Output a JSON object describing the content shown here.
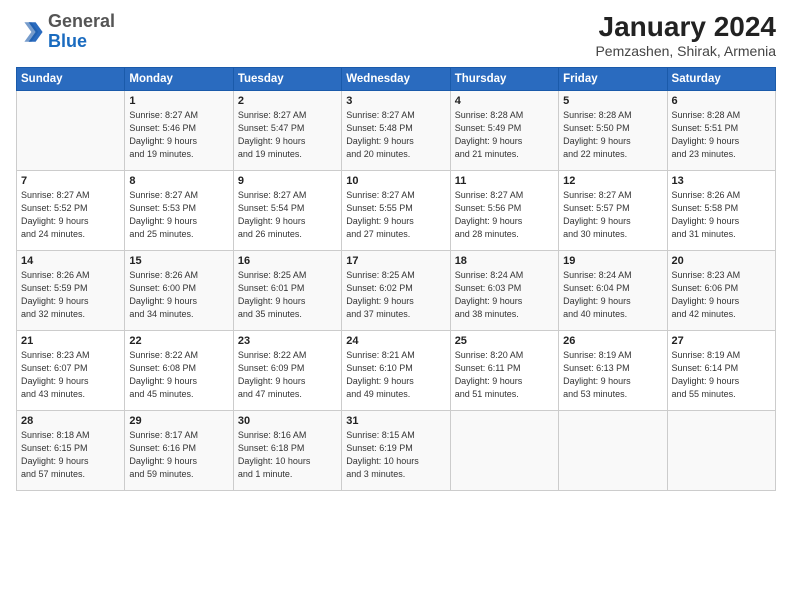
{
  "header": {
    "title": "January 2024",
    "subtitle": "Pemzashen, Shirak, Armenia",
    "logo_general": "General",
    "logo_blue": "Blue"
  },
  "days_of_week": [
    "Sunday",
    "Monday",
    "Tuesday",
    "Wednesday",
    "Thursday",
    "Friday",
    "Saturday"
  ],
  "weeks": [
    [
      {
        "day": "",
        "info": ""
      },
      {
        "day": "1",
        "info": "Sunrise: 8:27 AM\nSunset: 5:46 PM\nDaylight: 9 hours\nand 19 minutes."
      },
      {
        "day": "2",
        "info": "Sunrise: 8:27 AM\nSunset: 5:47 PM\nDaylight: 9 hours\nand 19 minutes."
      },
      {
        "day": "3",
        "info": "Sunrise: 8:27 AM\nSunset: 5:48 PM\nDaylight: 9 hours\nand 20 minutes."
      },
      {
        "day": "4",
        "info": "Sunrise: 8:28 AM\nSunset: 5:49 PM\nDaylight: 9 hours\nand 21 minutes."
      },
      {
        "day": "5",
        "info": "Sunrise: 8:28 AM\nSunset: 5:50 PM\nDaylight: 9 hours\nand 22 minutes."
      },
      {
        "day": "6",
        "info": "Sunrise: 8:28 AM\nSunset: 5:51 PM\nDaylight: 9 hours\nand 23 minutes."
      }
    ],
    [
      {
        "day": "7",
        "info": "Sunrise: 8:27 AM\nSunset: 5:52 PM\nDaylight: 9 hours\nand 24 minutes."
      },
      {
        "day": "8",
        "info": "Sunrise: 8:27 AM\nSunset: 5:53 PM\nDaylight: 9 hours\nand 25 minutes."
      },
      {
        "day": "9",
        "info": "Sunrise: 8:27 AM\nSunset: 5:54 PM\nDaylight: 9 hours\nand 26 minutes."
      },
      {
        "day": "10",
        "info": "Sunrise: 8:27 AM\nSunset: 5:55 PM\nDaylight: 9 hours\nand 27 minutes."
      },
      {
        "day": "11",
        "info": "Sunrise: 8:27 AM\nSunset: 5:56 PM\nDaylight: 9 hours\nand 28 minutes."
      },
      {
        "day": "12",
        "info": "Sunrise: 8:27 AM\nSunset: 5:57 PM\nDaylight: 9 hours\nand 30 minutes."
      },
      {
        "day": "13",
        "info": "Sunrise: 8:26 AM\nSunset: 5:58 PM\nDaylight: 9 hours\nand 31 minutes."
      }
    ],
    [
      {
        "day": "14",
        "info": "Sunrise: 8:26 AM\nSunset: 5:59 PM\nDaylight: 9 hours\nand 32 minutes."
      },
      {
        "day": "15",
        "info": "Sunrise: 8:26 AM\nSunset: 6:00 PM\nDaylight: 9 hours\nand 34 minutes."
      },
      {
        "day": "16",
        "info": "Sunrise: 8:25 AM\nSunset: 6:01 PM\nDaylight: 9 hours\nand 35 minutes."
      },
      {
        "day": "17",
        "info": "Sunrise: 8:25 AM\nSunset: 6:02 PM\nDaylight: 9 hours\nand 37 minutes."
      },
      {
        "day": "18",
        "info": "Sunrise: 8:24 AM\nSunset: 6:03 PM\nDaylight: 9 hours\nand 38 minutes."
      },
      {
        "day": "19",
        "info": "Sunrise: 8:24 AM\nSunset: 6:04 PM\nDaylight: 9 hours\nand 40 minutes."
      },
      {
        "day": "20",
        "info": "Sunrise: 8:23 AM\nSunset: 6:06 PM\nDaylight: 9 hours\nand 42 minutes."
      }
    ],
    [
      {
        "day": "21",
        "info": "Sunrise: 8:23 AM\nSunset: 6:07 PM\nDaylight: 9 hours\nand 43 minutes."
      },
      {
        "day": "22",
        "info": "Sunrise: 8:22 AM\nSunset: 6:08 PM\nDaylight: 9 hours\nand 45 minutes."
      },
      {
        "day": "23",
        "info": "Sunrise: 8:22 AM\nSunset: 6:09 PM\nDaylight: 9 hours\nand 47 minutes."
      },
      {
        "day": "24",
        "info": "Sunrise: 8:21 AM\nSunset: 6:10 PM\nDaylight: 9 hours\nand 49 minutes."
      },
      {
        "day": "25",
        "info": "Sunrise: 8:20 AM\nSunset: 6:11 PM\nDaylight: 9 hours\nand 51 minutes."
      },
      {
        "day": "26",
        "info": "Sunrise: 8:19 AM\nSunset: 6:13 PM\nDaylight: 9 hours\nand 53 minutes."
      },
      {
        "day": "27",
        "info": "Sunrise: 8:19 AM\nSunset: 6:14 PM\nDaylight: 9 hours\nand 55 minutes."
      }
    ],
    [
      {
        "day": "28",
        "info": "Sunrise: 8:18 AM\nSunset: 6:15 PM\nDaylight: 9 hours\nand 57 minutes."
      },
      {
        "day": "29",
        "info": "Sunrise: 8:17 AM\nSunset: 6:16 PM\nDaylight: 9 hours\nand 59 minutes."
      },
      {
        "day": "30",
        "info": "Sunrise: 8:16 AM\nSunset: 6:18 PM\nDaylight: 10 hours\nand 1 minute."
      },
      {
        "day": "31",
        "info": "Sunrise: 8:15 AM\nSunset: 6:19 PM\nDaylight: 10 hours\nand 3 minutes."
      },
      {
        "day": "",
        "info": ""
      },
      {
        "day": "",
        "info": ""
      },
      {
        "day": "",
        "info": ""
      }
    ]
  ]
}
